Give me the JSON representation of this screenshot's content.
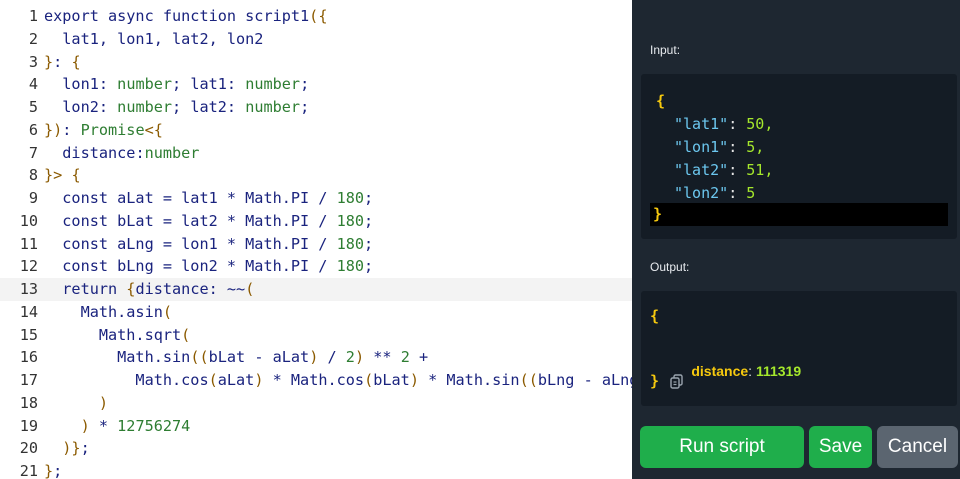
{
  "editor": {
    "lines": [
      {
        "n": "1",
        "tokens": [
          [
            "kw",
            "export async function script1"
          ],
          [
            "br",
            "({"
          ]
        ]
      },
      {
        "n": "2",
        "tokens": [
          [
            "pl",
            "  lat1, lon1, lat2, lon2"
          ]
        ]
      },
      {
        "n": "3",
        "tokens": [
          [
            "br",
            "}"
          ],
          [
            "pl",
            ": "
          ],
          [
            "br",
            "{"
          ]
        ]
      },
      {
        "n": "4",
        "tokens": [
          [
            "pl",
            "  lon1"
          ],
          [
            "pl",
            ": "
          ],
          [
            "ty",
            "number"
          ],
          [
            "pl",
            "; lat1"
          ],
          [
            "pl",
            ": "
          ],
          [
            "ty",
            "number"
          ],
          [
            "pl",
            ";"
          ]
        ]
      },
      {
        "n": "5",
        "tokens": [
          [
            "pl",
            "  lon2"
          ],
          [
            "pl",
            ": "
          ],
          [
            "ty",
            "number"
          ],
          [
            "pl",
            "; lat2"
          ],
          [
            "pl",
            ": "
          ],
          [
            "ty",
            "number"
          ],
          [
            "pl",
            ";"
          ]
        ]
      },
      {
        "n": "6",
        "tokens": [
          [
            "br",
            "})"
          ],
          [
            "pl",
            ": "
          ],
          [
            "ty",
            "Promise"
          ],
          [
            "br",
            "<{"
          ]
        ]
      },
      {
        "n": "7",
        "tokens": [
          [
            "pl",
            "  distance"
          ],
          [
            "pl",
            ":"
          ],
          [
            "ty",
            "number"
          ]
        ]
      },
      {
        "n": "8",
        "tokens": [
          [
            "br",
            "}>"
          ],
          [
            "pl",
            " "
          ],
          [
            "br",
            "{"
          ]
        ]
      },
      {
        "n": "9",
        "tokens": [
          [
            "pl",
            "  const aLat = lat1 * Math.PI / "
          ],
          [
            "nm",
            "180"
          ],
          [
            "pl",
            ";"
          ]
        ]
      },
      {
        "n": "10",
        "tokens": [
          [
            "pl",
            "  const bLat = lat2 * Math.PI / "
          ],
          [
            "nm",
            "180"
          ],
          [
            "pl",
            ";"
          ]
        ]
      },
      {
        "n": "11",
        "tokens": [
          [
            "pl",
            "  const aLng = lon1 * Math.PI / "
          ],
          [
            "nm",
            "180"
          ],
          [
            "pl",
            ";"
          ]
        ]
      },
      {
        "n": "12",
        "tokens": [
          [
            "pl",
            "  const bLng = lon2 * Math.PI / "
          ],
          [
            "nm",
            "180"
          ],
          [
            "pl",
            ";"
          ]
        ]
      },
      {
        "n": "13",
        "tokens": [
          [
            "pl",
            "  return "
          ],
          [
            "br",
            "{"
          ],
          [
            "pl",
            "distance: ~~"
          ],
          [
            "br",
            "("
          ]
        ],
        "active": true
      },
      {
        "n": "14",
        "tokens": [
          [
            "pl",
            "    Math.asin"
          ],
          [
            "br",
            "("
          ]
        ]
      },
      {
        "n": "15",
        "tokens": [
          [
            "pl",
            "      Math.sqrt"
          ],
          [
            "br",
            "("
          ]
        ]
      },
      {
        "n": "16",
        "tokens": [
          [
            "pl",
            "        Math.sin"
          ],
          [
            "br",
            "(("
          ],
          [
            "pl",
            "bLat - aLat"
          ],
          [
            "br",
            ")"
          ],
          [
            "pl",
            " / "
          ],
          [
            "nm",
            "2"
          ],
          [
            "br",
            ")"
          ],
          [
            "pl",
            " ** "
          ],
          [
            "nm",
            "2"
          ],
          [
            "pl",
            " +"
          ]
        ]
      },
      {
        "n": "17",
        "tokens": [
          [
            "pl",
            "          Math.cos"
          ],
          [
            "br",
            "("
          ],
          [
            "pl",
            "aLat"
          ],
          [
            "br",
            ")"
          ],
          [
            "pl",
            " * Math.cos"
          ],
          [
            "br",
            "("
          ],
          [
            "pl",
            "bLat"
          ],
          [
            "br",
            ")"
          ],
          [
            "pl",
            " * Math.sin"
          ],
          [
            "br",
            "(("
          ],
          [
            "pl",
            "bLng - aLng"
          ],
          [
            "br",
            ")"
          ]
        ]
      },
      {
        "n": "18",
        "tokens": [
          [
            "br",
            "      )"
          ]
        ]
      },
      {
        "n": "19",
        "tokens": [
          [
            "br",
            "    )"
          ],
          [
            "pl",
            " * "
          ],
          [
            "nm",
            "12756274"
          ]
        ]
      },
      {
        "n": "20",
        "tokens": [
          [
            "br",
            "  )}"
          ],
          [
            "pl",
            ";"
          ]
        ]
      },
      {
        "n": "21",
        "tokens": [
          [
            "br",
            "}"
          ],
          [
            "pl",
            ";"
          ]
        ]
      }
    ]
  },
  "panel": {
    "input_label": "Input:",
    "output_label": "Output:",
    "input_json": {
      "open": "{",
      "entries": [
        {
          "key": "\"lat1\"",
          "value": "50",
          "sep": ","
        },
        {
          "key": "\"lon1\"",
          "value": "5",
          "sep": ","
        },
        {
          "key": "\"lat2\"",
          "value": "51",
          "sep": ","
        },
        {
          "key": "\"lon2\"",
          "value": "5",
          "sep": ""
        }
      ],
      "close": "}"
    },
    "output": {
      "open": "{",
      "key": "distance",
      "value": "111319",
      "close": "}"
    },
    "buttons": {
      "run": "Run script",
      "save": "Save",
      "cancel": "Cancel"
    },
    "colors": {
      "background": "#1e2731",
      "box": "#141c25",
      "green": "#1fae4b",
      "gray": "#5b6570"
    }
  }
}
